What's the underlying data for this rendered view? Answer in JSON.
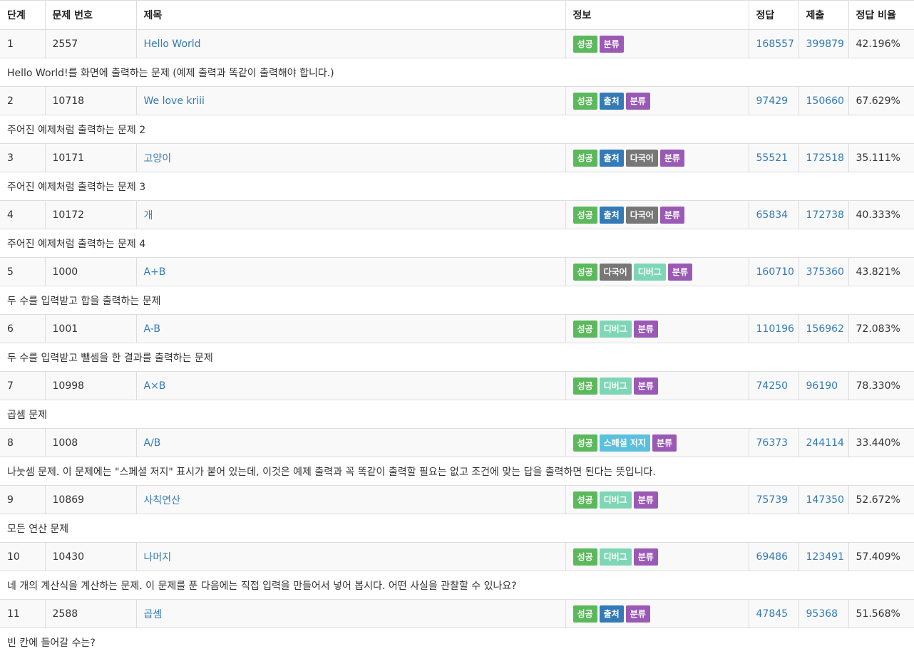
{
  "table": {
    "headers": [
      "단계",
      "문제 번호",
      "제목",
      "정보",
      "정답",
      "제출",
      "정답 비율"
    ],
    "rows": [
      {
        "step": "1",
        "id": "2557",
        "title": "Hello World",
        "labels": [
          {
            "text": "성공",
            "kind": "success"
          },
          {
            "text": "분류",
            "kind": "category"
          }
        ],
        "accepted": "168557",
        "submitted": "399879",
        "ratio": "42.196%",
        "desc": "Hello World!를 화면에 출력하는 문제 (예제 출력과 똑같이 출력해야 합니다.)"
      },
      {
        "step": "2",
        "id": "10718",
        "title": "We love kriii",
        "labels": [
          {
            "text": "성공",
            "kind": "success"
          },
          {
            "text": "출처",
            "kind": "source"
          },
          {
            "text": "분류",
            "kind": "category"
          }
        ],
        "accepted": "97429",
        "submitted": "150660",
        "ratio": "67.629%",
        "desc": "주어진 예제처럼 출력하는 문제 2"
      },
      {
        "step": "3",
        "id": "10171",
        "title": "고양이",
        "labels": [
          {
            "text": "성공",
            "kind": "success"
          },
          {
            "text": "출처",
            "kind": "source"
          },
          {
            "text": "다국어",
            "kind": "multilang"
          },
          {
            "text": "분류",
            "kind": "category"
          }
        ],
        "accepted": "55521",
        "submitted": "172518",
        "ratio": "35.111%",
        "desc": "주어진 예제처럼 출력하는 문제 3"
      },
      {
        "step": "4",
        "id": "10172",
        "title": "개",
        "labels": [
          {
            "text": "성공",
            "kind": "success"
          },
          {
            "text": "출처",
            "kind": "source"
          },
          {
            "text": "다국어",
            "kind": "multilang"
          },
          {
            "text": "분류",
            "kind": "category"
          }
        ],
        "accepted": "65834",
        "submitted": "172738",
        "ratio": "40.333%",
        "desc": "주어진 예제처럼 출력하는 문제 4"
      },
      {
        "step": "5",
        "id": "1000",
        "title": "A+B",
        "labels": [
          {
            "text": "성공",
            "kind": "success"
          },
          {
            "text": "다국어",
            "kind": "multilang"
          },
          {
            "text": "디버그",
            "kind": "debug"
          },
          {
            "text": "분류",
            "kind": "category"
          }
        ],
        "accepted": "160710",
        "submitted": "375360",
        "ratio": "43.821%",
        "desc": "두 수를 입력받고 합을 출력하는 문제"
      },
      {
        "step": "6",
        "id": "1001",
        "title": "A-B",
        "labels": [
          {
            "text": "성공",
            "kind": "success"
          },
          {
            "text": "디버그",
            "kind": "debug"
          },
          {
            "text": "분류",
            "kind": "category"
          }
        ],
        "accepted": "110196",
        "submitted": "156962",
        "ratio": "72.083%",
        "desc": "두 수를 입력받고 뺄셈을 한 결과를 출력하는 문제"
      },
      {
        "step": "7",
        "id": "10998",
        "title": "A×B",
        "labels": [
          {
            "text": "성공",
            "kind": "success"
          },
          {
            "text": "디버그",
            "kind": "debug"
          },
          {
            "text": "분류",
            "kind": "category"
          }
        ],
        "accepted": "74250",
        "submitted": "96190",
        "ratio": "78.330%",
        "desc": "곱셈 문제"
      },
      {
        "step": "8",
        "id": "1008",
        "title": "A/B",
        "labels": [
          {
            "text": "성공",
            "kind": "success"
          },
          {
            "text": "스페셜 저지",
            "kind": "special"
          },
          {
            "text": "분류",
            "kind": "category"
          }
        ],
        "accepted": "76373",
        "submitted": "244114",
        "ratio": "33.440%",
        "desc": "나눗셈 문제. 이 문제에는 \"스페셜 저지\" 표시가 붙어 있는데, 이것은 예제 출력과 꼭 똑같이 출력할 필요는 없고 조건에 맞는 답을 출력하면 된다는 뜻입니다."
      },
      {
        "step": "9",
        "id": "10869",
        "title": "사칙연산",
        "labels": [
          {
            "text": "성공",
            "kind": "success"
          },
          {
            "text": "디버그",
            "kind": "debug"
          },
          {
            "text": "분류",
            "kind": "category"
          }
        ],
        "accepted": "75739",
        "submitted": "147350",
        "ratio": "52.672%",
        "desc": "모든 연산 문제"
      },
      {
        "step": "10",
        "id": "10430",
        "title": "나머지",
        "labels": [
          {
            "text": "성공",
            "kind": "success"
          },
          {
            "text": "디버그",
            "kind": "debug"
          },
          {
            "text": "분류",
            "kind": "category"
          }
        ],
        "accepted": "69486",
        "submitted": "123491",
        "ratio": "57.409%",
        "desc": "네 개의 계산식을 계산하는 문제. 이 문제를 푼 다음에는 직접 입력을 만들어서 넣어 봅시다. 어떤 사실을 관찰할 수 있나요?"
      },
      {
        "step": "11",
        "id": "2588",
        "title": "곱셈",
        "labels": [
          {
            "text": "성공",
            "kind": "success"
          },
          {
            "text": "출처",
            "kind": "source"
          },
          {
            "text": "분류",
            "kind": "category"
          }
        ],
        "accepted": "47845",
        "submitted": "95368",
        "ratio": "51.568%",
        "desc": "빈 칸에 들어갈 수는?"
      }
    ]
  },
  "label_colors": {
    "success": "#5cb85c",
    "source": "#337ab7",
    "multilang": "#777777",
    "debug": "#7fd6b7",
    "special": "#5bc0de",
    "category": "#9b59b6"
  },
  "link_color": "#337ab7"
}
